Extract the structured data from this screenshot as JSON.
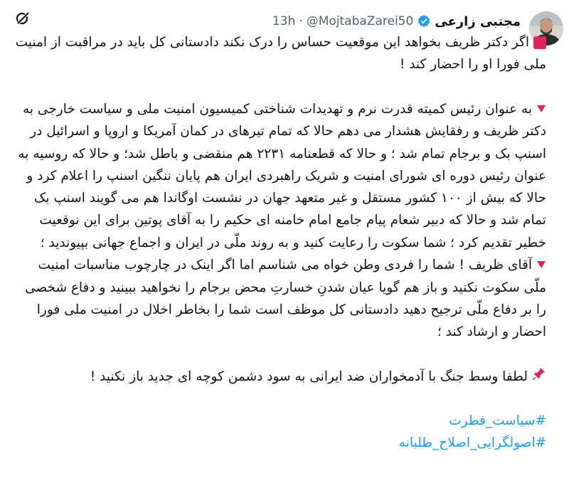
{
  "tweet": {
    "author_name": "مجتبی زارعی",
    "handle": "@MojtabaZarei50",
    "separator": "·",
    "time": "13h",
    "paragraphs": [
      "اگر دکتر ظریف بخواهد این موقعیت حساس را درک نکند دادستانی کل باید در مراقبت از امنیت ملی فورا او را احضار کند !",
      "به عنوان رئیس کمیته قدرت نرم و تهدیدات شناختی کمیسیون امنیت ملی و سیاست خارجی به دکتر ظریف و رفقایش هشدار می دهم حالا که تمام تیرهای در کمان آمریکا و اروپا و اسرائیل در اسنپ بک و برجام تمام شد ؛ و حالا که  قطعنامه ۲۲۳۱ هم منقضی و باطل شد؛ و حالا که روسیه به عنوان رئیس دوره ای شورای امنیت و شریک راهبردی ایران هم پایان ننگین اسنپ را اعلام کرد و حالا که بیش از ۱۰۰ کشور مستقل و غیر متعهد جهان در نشست اوگاندا هم می گویند اسنپ بک تمام شد و حالا که دبیر شعام پیام جامع امام خامنه ای حکیم را به آقای پوتین برای این نوقعیت خطیر تقدیم کرد ؛ شما سکوت را رعایت کنید و به روند ملّی در ایران و اجماع جهانی بپیوندید ؛",
      "آقای ظریف ! شما را فردی وطن خواه می شناسم اما اگر اینک در چارچوب مناسبات امنیت ملّی  سکوت نکنید و باز هم گویا عیان شدنِ خسارتِ محض برجام را نخواهید ببینید و دفاع شخصی را بر دفاع ملّی ترجیح دهید دادستانی کل موظف است شما را بخاطر اخلال در امنیت ملی فورا احضار و ارشاد کند ؛",
      "لطفا وسط جنگ با آدمخواران ضد ایرانی به سود دشمن کوچه ای جدید باز نکنید !"
    ],
    "hashtags": [
      "#سیاست_فطرت",
      "#اصولگرایی_اصلاح_طلبانه"
    ]
  },
  "icons": {
    "top_left": "grok-icon",
    "verified": "verified-badge-icon",
    "para1_marker": "red-square-icon",
    "para2_marker": "red-triangle-icon",
    "para3_marker": "red-triangle-icon",
    "para4_marker": "pushpin-icon"
  },
  "colors": {
    "accent": "#1d9bf0",
    "text": "#0f1419",
    "muted": "#536471",
    "marker_red": "#e0245e"
  }
}
